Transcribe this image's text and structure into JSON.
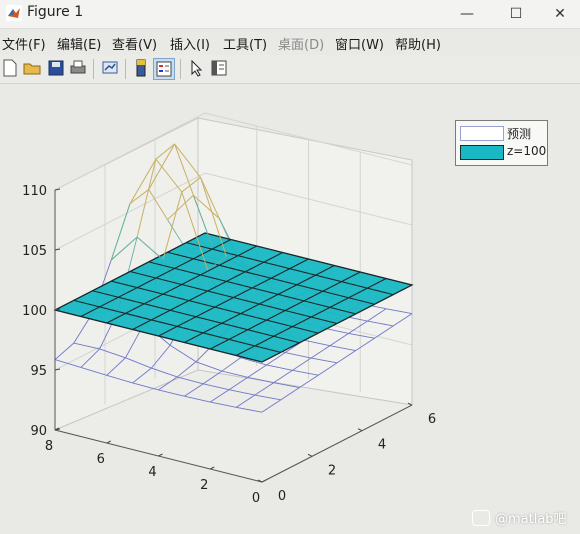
{
  "window": {
    "title": "Figure 1",
    "controls": {
      "minimize": "—",
      "maximize": "☐",
      "close": "✕"
    }
  },
  "menu": [
    "文件(F)",
    "编辑(E)",
    "查看(V)",
    "插入(I)",
    "工具(T)",
    "桌面(D)",
    "窗口(W)",
    "帮助(H)"
  ],
  "toolbar": {
    "icons": [
      "new-figure-icon",
      "open-file-icon",
      "save-icon",
      "print-icon",
      "link-plot-icon",
      "colorbar-icon",
      "legend-icon",
      "pointer-icon",
      "property-editor-icon"
    ]
  },
  "colors": {
    "plane_fill": "#1ab8c4",
    "plane_edge": "#1a2a2a",
    "mesh_blue": "#6f78c8",
    "mesh_yellow": "#c9b56a",
    "mesh_green": "#68b0a0"
  },
  "legend": {
    "entries": [
      {
        "label": "预测",
        "style": "mesh"
      },
      {
        "label": "z=100",
        "style": "surface"
      }
    ]
  },
  "chart_data": {
    "type": "surface",
    "x_ticks": [
      "0",
      "2",
      "4",
      "6"
    ],
    "y_ticks": [
      "0",
      "2",
      "4",
      "6",
      "8"
    ],
    "z_ticks": [
      "90",
      "95",
      "100",
      "105",
      "110"
    ],
    "xlim": [
      0,
      6
    ],
    "ylim": [
      0,
      8
    ],
    "zlim": [
      90,
      110
    ],
    "series": [
      {
        "name": "预测",
        "style": "mesh"
      },
      {
        "name": "z=100",
        "style": "flat-surface",
        "z": 100
      }
    ]
  },
  "watermark": {
    "text": "@matlab吧"
  }
}
